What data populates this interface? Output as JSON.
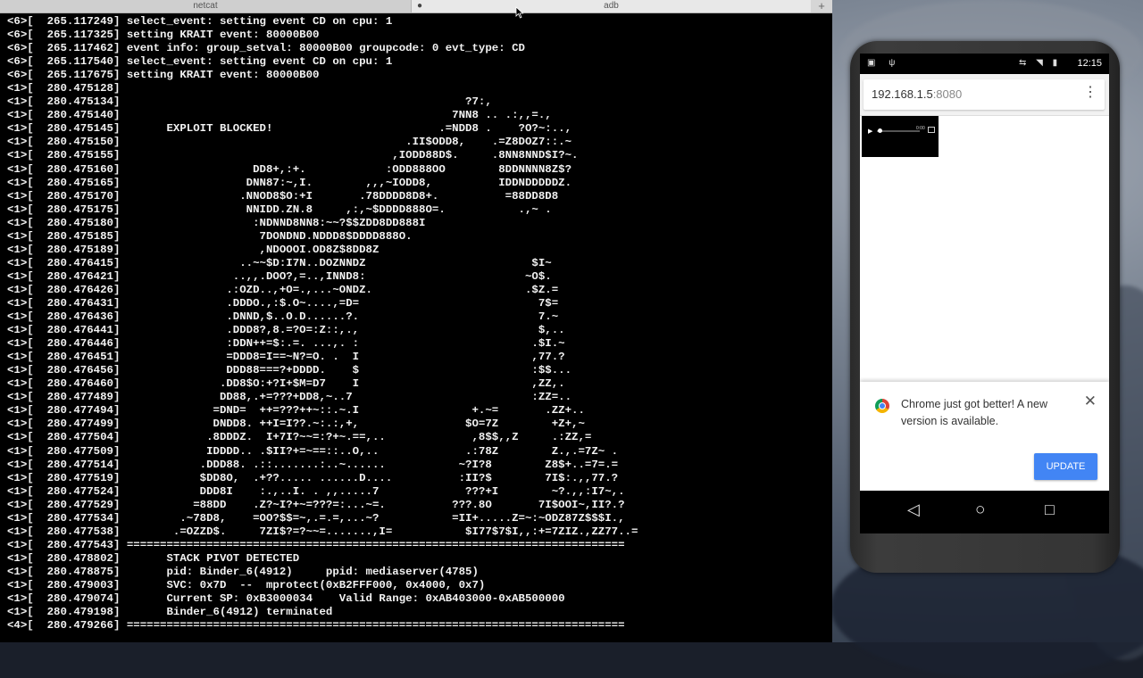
{
  "terminal": {
    "tabs": [
      {
        "label": "netcat",
        "active": false
      },
      {
        "label": "adb",
        "active": true,
        "indicator": "●"
      }
    ],
    "add_tab": "+",
    "lines": [
      "<6>[  265.117249] select_event: setting event CD on cpu: 1",
      "<6>[  265.117325] setting KRAIT event: 80000B00",
      "<6>[  265.117462] event info: group_setval: 80000B00 groupcode: 0 evt_type: CD",
      "<6>[  265.117540] select_event: setting event CD on cpu: 1",
      "<6>[  265.117675] setting KRAIT event: 80000B00",
      "<1>[  280.475128]",
      "<1>[  280.475134]                                                    ?7:,",
      "<1>[  280.475140]                                                  7NN8 .. .:,,=.,",
      "<1>[  280.475145]       EXPLOIT BLOCKED!                         .=NDD8 .    ?O?~:..,",
      "<1>[  280.475150]                                           .II$ODD8,    .=Z8DOZ7::.~",
      "<1>[  280.475155]                                         ,IODD88D$.     .8NN8NND$I?~.",
      "<1>[  280.475160]                    DD8+,:+.            :ODD888OO        8DDNNNN8Z$?",
      "<1>[  280.475165]                   DNN87:~,I.        ,,,~IODD8,          IDDNDDDDDZ.",
      "<1>[  280.475170]                  .NNOD8$O:+I       .78DDDD8D8+.          =88DD8D8",
      "<1>[  280.475175]                   NNIDD.ZN.8     ,:,~$DDDD888O=.           .,~ .",
      "<1>[  280.475180]                    :NDNND8NN8:~~?$$ZDD8DD888I",
      "<1>[  280.475185]                     7DONDND.NDDD8$DDDD888O.",
      "<1>[  280.475189]                     ,NDOOOI.OD8Z$8DD8Z",
      "<1>[  280.476415]                  ..~~$D:I7N..DOZNNDZ                         $I~",
      "<1>[  280.476421]                 ..,,.DOO?,=..,INND8:                        ~O$.",
      "<1>[  280.476426]                .:OZD..,+O=.,...~ONDZ.                       .$Z.=",
      "<1>[  280.476431]                .DDDO.,:$.O~....,=D=                           7$=",
      "<1>[  280.476436]                .DNND,$..O.D......?.                           7.~",
      "<1>[  280.476441]                .DDD8?,8.=?O=:Z::,.,                           $,..",
      "<1>[  280.476446]                :DDN++=$:.=. ...,. :                          .$I.~",
      "<1>[  280.476451]                =DDD8=I==~N?=O. .  I                          ,77.?",
      "<1>[  280.476456]                DDD88===?+DDDD.    $                          :$$...",
      "<1>[  280.476460]               .DD8$O:+?I+$M=D7    I                          ,ZZ,.",
      "<1>[  280.477489]               DD88,.+=???+DD8,~..7                           :ZZ=..",
      "<1>[  280.477494]              =DND=  ++=???++~::.~.I                 +.~=       .ZZ+..",
      "<1>[  280.477499]              DNDD8. ++I=I??.~:.:,+,                $O=7Z        +Z+,~",
      "<1>[  280.477504]             .8DDDZ.  I+7I?~~=:?+~.==,..             ,8$$,,Z     .:ZZ,=",
      "<1>[  280.477509]             IDDDD.. .$II?+=~==::..O,..             .:78Z        Z.,.=7Z~ .",
      "<1>[  280.477514]            .DDD88. .::.......:..~......           ~?I?8        Z8$+..=7=.=",
      "<1>[  280.477519]            $DD8O,  .+??..... ......D....          :II?$        7I$:.,,77.?",
      "<1>[  280.477524]            DDD8I    :.,..I. . ,,.....7             ???+I        ~?.,,:I7~,.",
      "<1>[  280.477529]           =88DD    .Z?~I?+~=???=:...~=.          ???.8O       7I$OOI~,II?.?",
      "<1>[  280.477534]         .~78D8,    =OO?$$=~,.=.=,...~?           =II+.....Z=~:~ODZ87Z$$$I.,",
      "<1>[  280.477538]        .=OZZD$.     7ZI$?=?~~=.......,I=           $I77$7$I,,:+=7ZIZ.,ZZ77..=",
      "<1>[  280.477543] ===========================================================================",
      "<1>[  280.478802]       STACK PIVOT DETECTED",
      "<1>[  280.478875]       pid: Binder_6(4912)     ppid: mediaserver(4785)",
      "<1>[  280.479003]       SVC: 0x7D  --  mprotect(0xB2FFF000, 0x4000, 0x7)",
      "<1>[  280.479074]       Current SP: 0xB3000034    Valid Range: 0xAB403000-0xAB500000",
      "<1>[  280.479198]       Binder_6(4912) terminated",
      "<4>[  280.479266] ==========================================================================="
    ]
  },
  "phone": {
    "status_bar": {
      "left_icons": [
        "android-icon",
        "usb-icon"
      ],
      "right_icons": [
        "cast-icon",
        "wifi-icon",
        "battery-icon"
      ],
      "time": "12:15"
    },
    "browser": {
      "url_host": "192.168.1.5",
      "url_port": ":8080",
      "menu": "⋮"
    },
    "video": {
      "time": "0:00"
    },
    "infobar": {
      "message": "Chrome just got better! A new version is available.",
      "close": "✕",
      "button": "UPDATE"
    },
    "nav": {
      "back": "◁",
      "home": "○",
      "recent": "□"
    }
  }
}
